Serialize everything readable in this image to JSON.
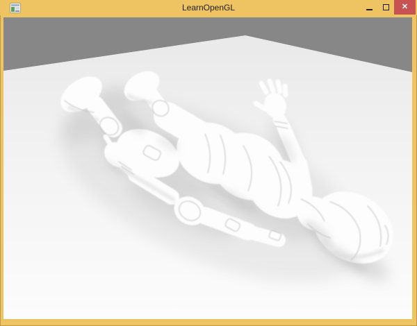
{
  "window": {
    "title": "LearnOpenGL",
    "controls": {
      "minimize_glyph": "–",
      "maximize_glyph": "□",
      "close_glyph": "✕"
    }
  },
  "colors": {
    "titlebar": "#eec462",
    "border": "#eec462",
    "title_text": "#1c1c1c",
    "close_button": "#c85151",
    "close_glyph": "#ffffff",
    "background": "#878787",
    "floor_light": "#fcfcfc",
    "floor_dark": "#e9e9e9",
    "model_white": "#fdfdfd",
    "shadow_gray": "#8f8f8f"
  },
  "scene": {
    "viewport_label": "opengl-render-viewport",
    "objects": [
      "floor-plane",
      "humanoid-suit-model-lying"
    ]
  }
}
